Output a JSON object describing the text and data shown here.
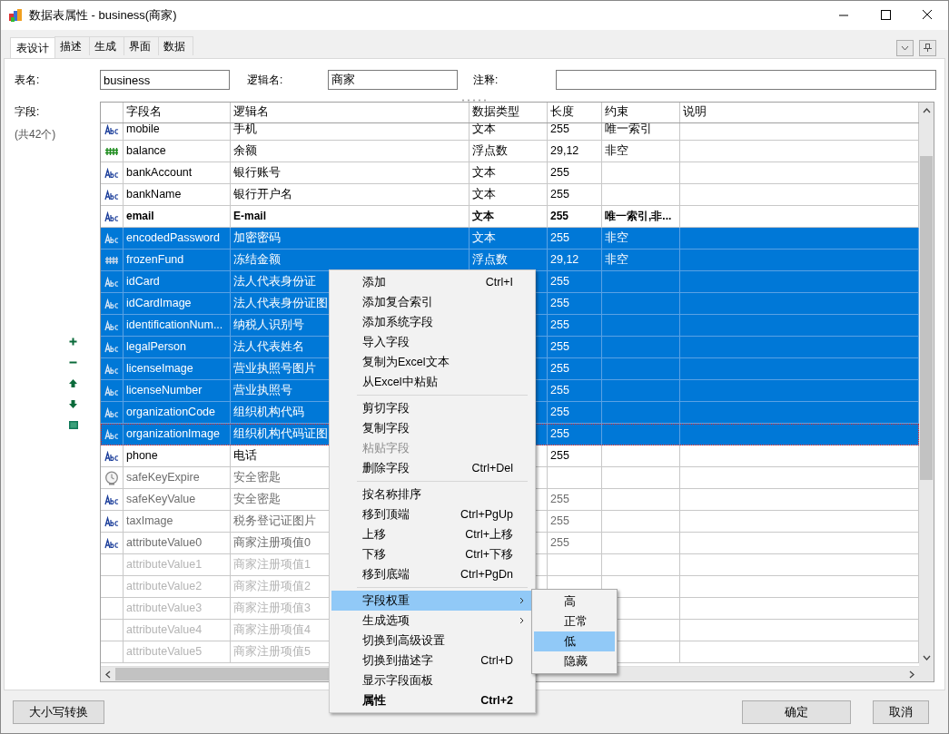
{
  "window": {
    "title": "数据表属性 - business(商家)"
  },
  "tabs": [
    {
      "label": "表设计",
      "selected": true
    },
    {
      "label": "描述",
      "selected": false
    },
    {
      "label": "生成",
      "selected": false
    },
    {
      "label": "界面",
      "selected": false
    },
    {
      "label": "数据",
      "selected": false
    }
  ],
  "form": {
    "table_name_label": "表名:",
    "table_name": "business",
    "logical_name_label": "逻辑名:",
    "logical_name": "商家",
    "comment_label": "注释:"
  },
  "fields_panel": {
    "label": "字段:",
    "count": "(共42个)"
  },
  "table": {
    "columns": [
      "字段名",
      "逻辑名",
      "数据类型",
      "长度",
      "约束",
      "说明"
    ],
    "rows": [
      {
        "kind": "text",
        "cells": [
          "mobile",
          "手机",
          "文本",
          "255",
          "唯一索引"
        ],
        "bold": false,
        "color": "#000000",
        "selected": false,
        "focused": false
      },
      {
        "kind": "number",
        "cells": [
          "balance",
          "余额",
          "浮点数",
          "29,12",
          "非空"
        ],
        "bold": false,
        "color": "#000000",
        "selected": false,
        "focused": false
      },
      {
        "kind": "text",
        "cells": [
          "bankAccount",
          "银行账号",
          "文本",
          "255"
        ],
        "bold": false,
        "color": "#000000",
        "selected": false,
        "focused": false
      },
      {
        "kind": "text",
        "cells": [
          "bankName",
          "银行开户名",
          "文本",
          "255"
        ],
        "bold": false,
        "color": "#000000",
        "selected": false,
        "focused": false
      },
      {
        "kind": "text",
        "cells": [
          "email",
          "E-mail",
          "文本",
          "255",
          "唯一索引,非..."
        ],
        "bold": true,
        "color": "#000000",
        "selected": false,
        "focused": false
      },
      {
        "kind": "text",
        "cells": [
          "encodedPassword",
          "加密密码",
          "文本",
          "255",
          "非空"
        ],
        "bold": false,
        "color": "#ffffff",
        "selected": true,
        "focused": false
      },
      {
        "kind": "number",
        "cells": [
          "frozenFund",
          "冻结金额",
          "浮点数",
          "29,12",
          "非空"
        ],
        "bold": false,
        "color": "#ffffff",
        "selected": true,
        "focused": false
      },
      {
        "kind": "text",
        "cells": [
          "idCard",
          "法人代表身份证",
          null,
          "255"
        ],
        "bold": false,
        "color": "#ffffff",
        "selected": true,
        "focused": false
      },
      {
        "kind": "text",
        "cells": [
          "idCardImage",
          "法人代表身份证图",
          null,
          "255"
        ],
        "bold": false,
        "color": "#ffffff",
        "selected": true,
        "focused": false
      },
      {
        "kind": "text",
        "cells": [
          "identificationNum...",
          "纳税人识别号",
          null,
          "255"
        ],
        "bold": false,
        "color": "#ffffff",
        "selected": true,
        "focused": false
      },
      {
        "kind": "text",
        "cells": [
          "legalPerson",
          "法人代表姓名",
          null,
          "255"
        ],
        "bold": false,
        "color": "#ffffff",
        "selected": true,
        "focused": false
      },
      {
        "kind": "text",
        "cells": [
          "licenseImage",
          "营业执照号图片",
          null,
          "255"
        ],
        "bold": false,
        "color": "#ffffff",
        "selected": true,
        "focused": false
      },
      {
        "kind": "text",
        "cells": [
          "licenseNumber",
          "营业执照号",
          null,
          "255"
        ],
        "bold": false,
        "color": "#ffffff",
        "selected": true,
        "focused": false
      },
      {
        "kind": "text",
        "cells": [
          "organizationCode",
          "组织机构代码",
          null,
          "255"
        ],
        "bold": false,
        "color": "#ffffff",
        "selected": true,
        "focused": false
      },
      {
        "kind": "text",
        "cells": [
          "organizationImage",
          "组织机构代码证图",
          null,
          "255"
        ],
        "bold": false,
        "color": "#ffffff",
        "selected": true,
        "focused": true
      },
      {
        "kind": "text",
        "cells": [
          "phone",
          "电话",
          null,
          "255"
        ],
        "bold": false,
        "color": "#000000",
        "selected": false,
        "focused": false
      },
      {
        "kind": "time",
        "cells": [
          "safeKeyExpire",
          "安全密匙"
        ],
        "bold": false,
        "color": "#6d6d6d",
        "selected": false,
        "focused": false
      },
      {
        "kind": "text",
        "cells": [
          "safeKeyValue",
          "安全密匙",
          null,
          "255"
        ],
        "bold": false,
        "color": "#6d6d6d",
        "selected": false,
        "focused": false
      },
      {
        "kind": "text",
        "cells": [
          "taxImage",
          "税务登记证图片",
          null,
          "255"
        ],
        "bold": false,
        "color": "#6d6d6d",
        "selected": false,
        "focused": false
      },
      {
        "kind": "text",
        "cells": [
          "attributeValue0",
          "商家注册项值0",
          null,
          "255"
        ],
        "bold": false,
        "color": "#6d6d6d",
        "selected": false,
        "focused": false
      },
      {
        "kind": "none",
        "cells": [
          "attributeValue1",
          "商家注册项值1"
        ],
        "bold": false,
        "color": "#b4b4b4",
        "selected": false,
        "focused": false
      },
      {
        "kind": "none",
        "cells": [
          "attributeValue2",
          "商家注册项值2"
        ],
        "bold": false,
        "color": "#b4b4b4",
        "selected": false,
        "focused": false
      },
      {
        "kind": "none",
        "cells": [
          "attributeValue3",
          "商家注册项值3"
        ],
        "bold": false,
        "color": "#b4b4b4",
        "selected": false,
        "focused": false
      },
      {
        "kind": "none",
        "cells": [
          "attributeValue4",
          "商家注册项值4"
        ],
        "bold": false,
        "color": "#b4b4b4",
        "selected": false,
        "focused": false
      },
      {
        "kind": "none",
        "cells": [
          "attributeValue5",
          "商家注册项值5"
        ],
        "bold": false,
        "color": "#b4b4b4",
        "selected": false,
        "focused": false
      }
    ]
  },
  "context_menu": {
    "groups": [
      [
        {
          "kind": "command",
          "label": "添加",
          "shortcut": "Ctrl+I",
          "selected": false,
          "disabled": false,
          "default": false
        },
        {
          "kind": "command",
          "label": "添加复合索引",
          "selected": false,
          "disabled": false,
          "default": false
        },
        {
          "kind": "command",
          "label": "添加系统字段",
          "selected": false,
          "disabled": false,
          "default": false
        },
        {
          "kind": "command",
          "label": "导入字段",
          "selected": false,
          "disabled": false,
          "default": false
        },
        {
          "kind": "command",
          "label": "复制为Excel文本",
          "selected": false,
          "disabled": false,
          "default": false
        },
        {
          "kind": "command",
          "label": "从Excel中粘贴",
          "selected": false,
          "disabled": false,
          "default": false
        }
      ],
      [
        {
          "kind": "command",
          "label": "剪切字段",
          "selected": false,
          "disabled": false,
          "default": false
        },
        {
          "kind": "command",
          "label": "复制字段",
          "selected": false,
          "disabled": false,
          "default": false
        },
        {
          "kind": "command",
          "label": "粘贴字段",
          "selected": false,
          "disabled": true,
          "default": false
        },
        {
          "kind": "command",
          "label": "删除字段",
          "shortcut": "Ctrl+Del",
          "selected": false,
          "disabled": false,
          "default": false
        }
      ],
      [
        {
          "kind": "command",
          "label": "按名称排序",
          "selected": false,
          "disabled": false,
          "default": false
        },
        {
          "kind": "command",
          "label": "移到顶端",
          "shortcut": "Ctrl+PgUp",
          "selected": false,
          "disabled": false,
          "default": false
        },
        {
          "kind": "command",
          "label": "上移",
          "shortcut": "Ctrl+上移",
          "selected": false,
          "disabled": false,
          "default": false
        },
        {
          "kind": "command",
          "label": "下移",
          "shortcut": "Ctrl+下移",
          "selected": false,
          "disabled": false,
          "default": false
        },
        {
          "kind": "command",
          "label": "移到底端",
          "shortcut": "Ctrl+PgDn",
          "selected": false,
          "disabled": false,
          "default": false
        }
      ],
      [
        {
          "kind": "submenu",
          "label": "字段权重",
          "selected": true,
          "disabled": false,
          "default": false
        },
        {
          "kind": "submenu",
          "label": "生成选项",
          "selected": false,
          "disabled": false,
          "default": false
        },
        {
          "kind": "command",
          "label": "切换到高级设置",
          "selected": false,
          "disabled": false,
          "default": false
        },
        {
          "kind": "command",
          "label": "切换到描述字",
          "shortcut": "Ctrl+D",
          "selected": false,
          "disabled": false,
          "default": false
        },
        {
          "kind": "command",
          "label": "显示字段面板",
          "selected": false,
          "disabled": false,
          "default": false
        },
        {
          "kind": "command",
          "label": "属性",
          "shortcut": "Ctrl+2",
          "selected": false,
          "disabled": false,
          "default": true
        }
      ]
    ]
  },
  "submenu": [
    {
      "label": "高",
      "selected": false
    },
    {
      "label": "正常",
      "selected": false
    },
    {
      "label": "低",
      "selected": true
    },
    {
      "label": "隐藏",
      "selected": false
    }
  ],
  "buttons": {
    "case_convert": "大小写转换",
    "ok": "确定",
    "cancel": "取消"
  }
}
